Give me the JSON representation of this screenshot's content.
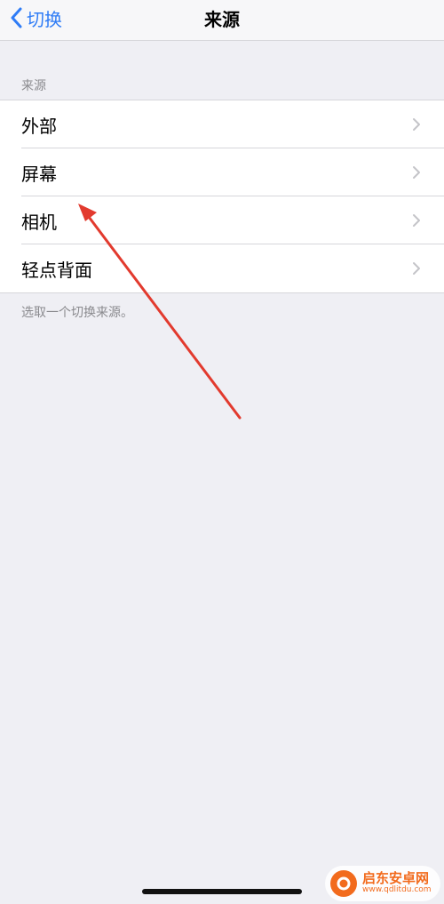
{
  "nav": {
    "back_label": "切换",
    "title": "来源"
  },
  "section": {
    "header": "来源",
    "items": [
      {
        "label": "外部"
      },
      {
        "label": "屏幕"
      },
      {
        "label": "相机"
      },
      {
        "label": "轻点背面"
      }
    ],
    "footer": "选取一个切换来源。"
  },
  "watermark": {
    "name": "启东安卓网",
    "url": "www.qdlitdu.com"
  },
  "colors": {
    "accent": "#2f7cf6",
    "background": "#efeff4",
    "annotation_arrow": "#e23a2e"
  },
  "icons": {
    "back": "chevron-left-icon",
    "disclosure": "chevron-right-icon"
  }
}
